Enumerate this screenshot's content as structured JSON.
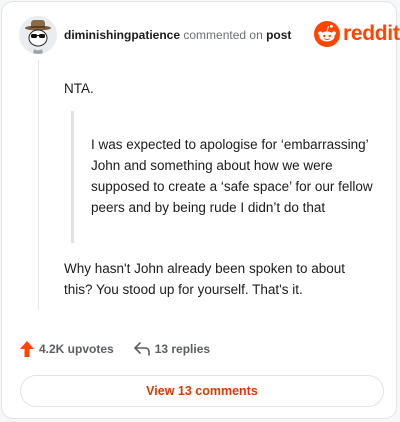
{
  "comment": {
    "username": "diminishingpatience",
    "verb": "commented on",
    "target": "post",
    "paragraphs": [
      "NTA.",
      "Why hasn't John already been spoken to about this? You stood up for yourself. That's it."
    ],
    "quote": "I was expected to apologise for ‘embarrassing’ John and something about how we were supposed to create a ‘safe space’ for our fellow peers and by being rude I didn’t do that"
  },
  "brand": {
    "name": "reddit",
    "color": "#ff4500"
  },
  "actions": {
    "upvotes": "4.2K upvotes",
    "replies": "13 replies",
    "upvote_icon": "upvote-arrow-icon",
    "reply_icon": "reply-arrow-icon"
  },
  "view_comments_label": "View 13 comments",
  "colors": {
    "accent": "#d93a00",
    "upvote": "#ff4500"
  }
}
